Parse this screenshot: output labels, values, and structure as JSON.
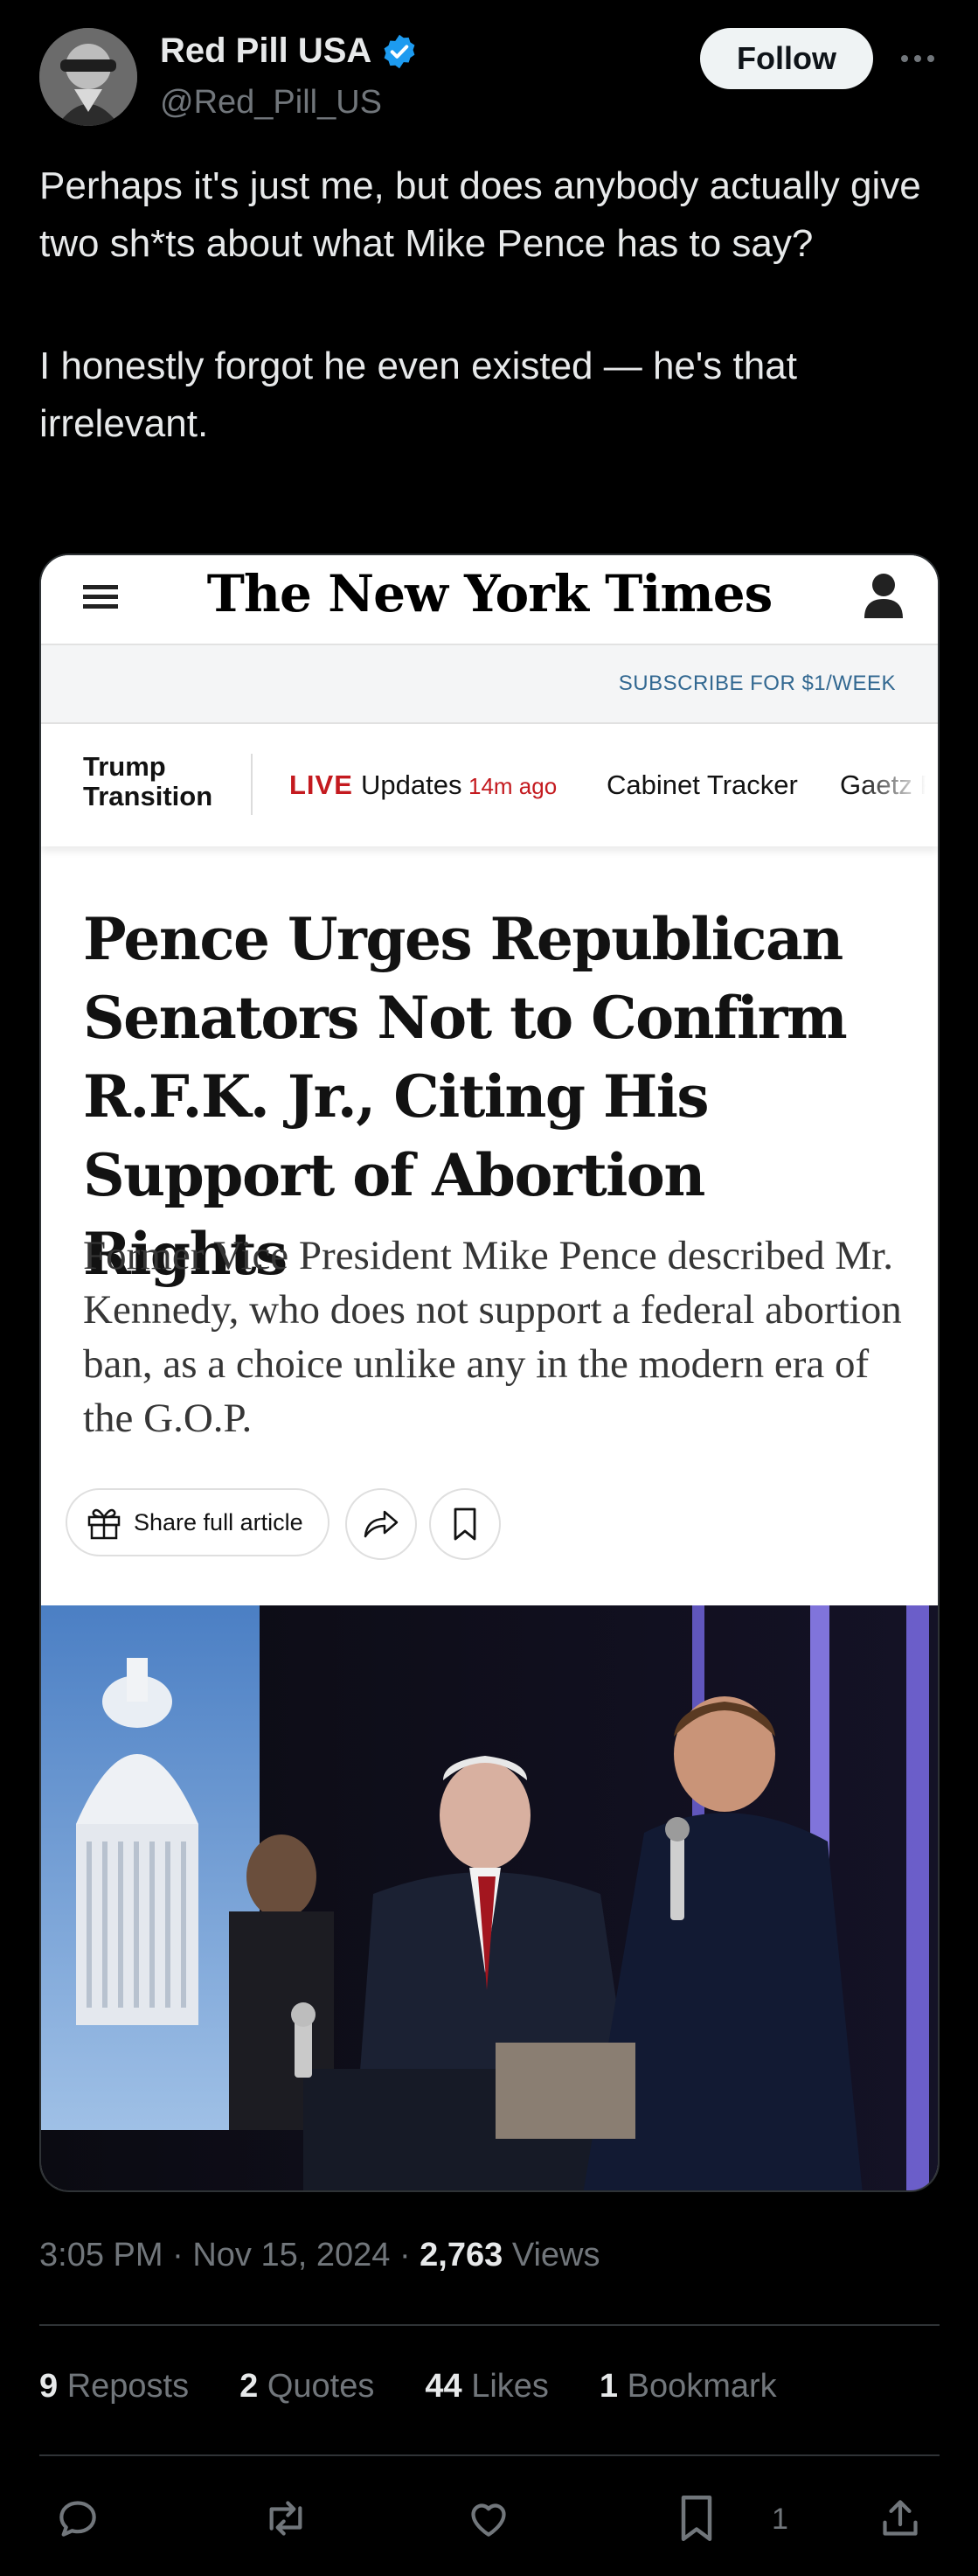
{
  "author": {
    "name": "Red Pill USA",
    "handle": "@Red_Pill_US",
    "verified_color": "#1d9bf0"
  },
  "follow_label": "Follow",
  "tweet": {
    "paragraph1": "Perhaps it's just me, but does anybody actually give two sh*ts about what Mike Pence has to say?",
    "paragraph2": "I honestly forgot he even existed — he's that irrelevant."
  },
  "card": {
    "logo": "The New York Times",
    "subscribe": "SUBSCRIBE FOR $1/WEEK",
    "nav": {
      "section": "Trump Transition",
      "live": "LIVE",
      "updates": "Updates",
      "ago": "14m ago",
      "cabinet": "Cabinet Tracker",
      "gaetz": "Gaetz P"
    },
    "headline": "Pence Urges Republican Senators Not to Confirm R.F.K. Jr., Citing His Support of Abortion Rights",
    "summary": "Former Vice President Mike Pence described Mr. Kennedy, who does not support a federal abortion ban, as a choice unlike any in the modern era of the G.O.P.",
    "share_label": "Share full article"
  },
  "meta": {
    "time": "3:05 PM",
    "date": "Nov 15, 2024",
    "views_count": "2,763",
    "views_label": "Views",
    "sep": "·"
  },
  "stats": {
    "reposts_count": "9",
    "reposts_label": "Reposts",
    "quotes_count": "2",
    "quotes_label": "Quotes",
    "likes_count": "44",
    "likes_label": "Likes",
    "bookmarks_count": "1",
    "bookmarks_label": "Bookmark"
  },
  "actions": {
    "bookmark_count": "1"
  },
  "colors": {
    "background": "#000000",
    "text": "#e7e9ea",
    "secondary": "#71767b",
    "nyt_live_red": "#c41a1f",
    "nyt_link_blue": "#326891"
  }
}
